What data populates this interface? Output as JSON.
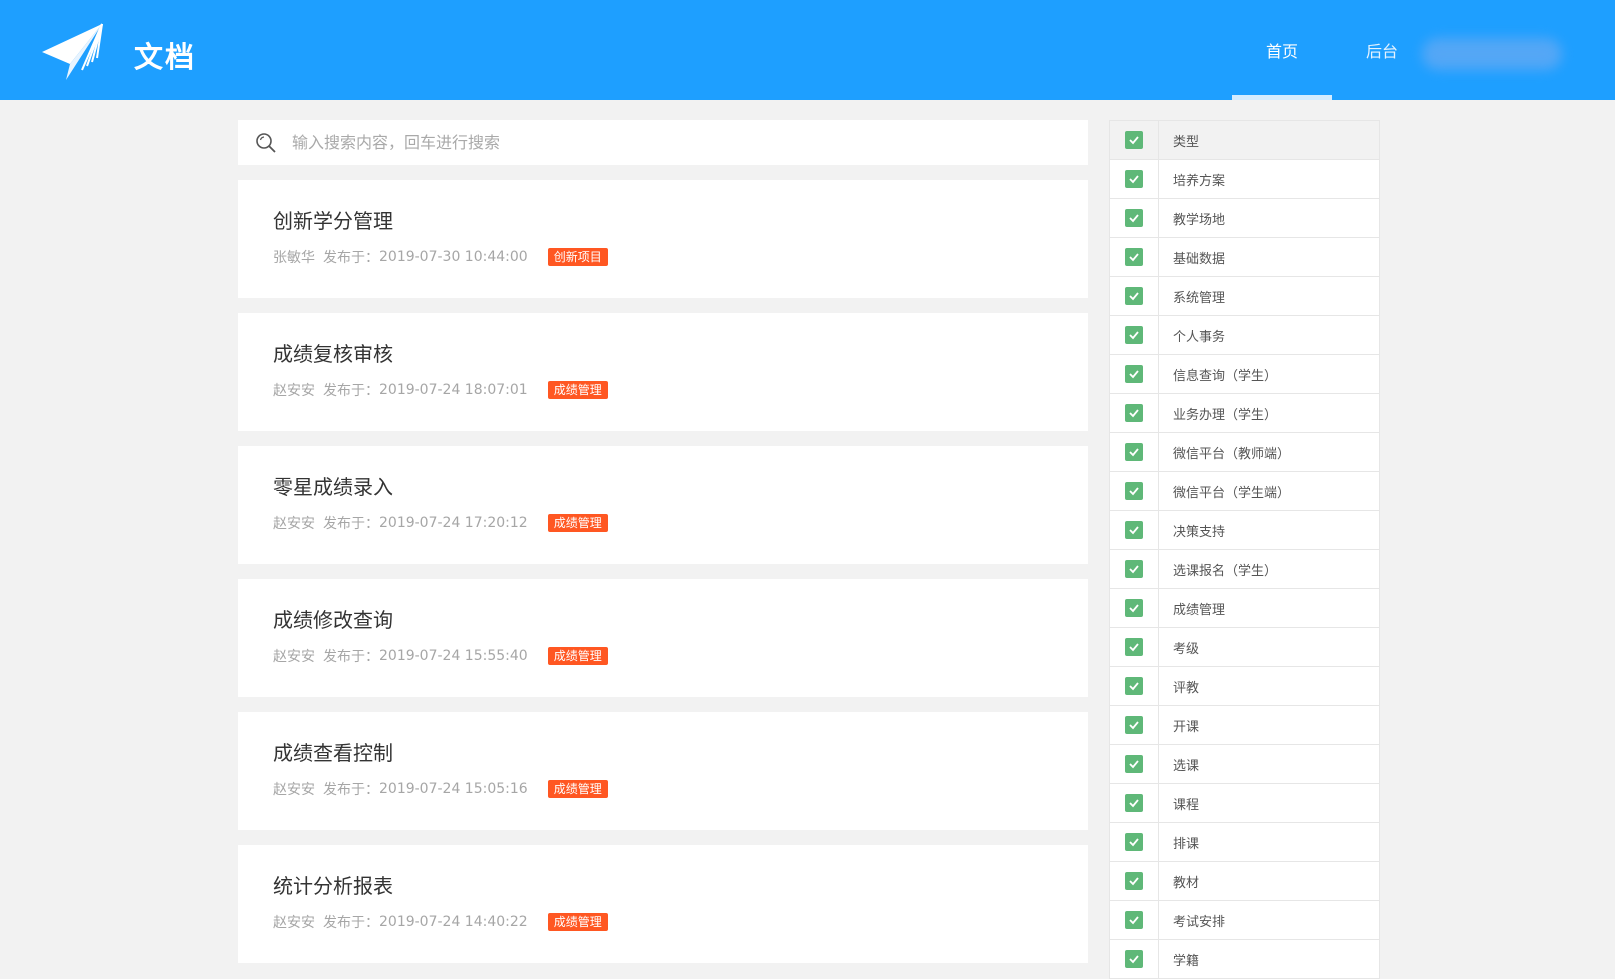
{
  "header": {
    "brand": "文档",
    "logo_icon": "paper-plane-icon",
    "nav": [
      {
        "label": "首页",
        "active": true
      },
      {
        "label": "后台",
        "active": false
      }
    ],
    "accent": "#1e9fff"
  },
  "search": {
    "placeholder": "输入搜索内容，回车进行搜索",
    "value": ""
  },
  "docs": [
    {
      "title": "创新学分管理",
      "author": "张敏华",
      "published_label": "发布于：",
      "date": "2019-07-30 10:44:00",
      "tag": "创新项目"
    },
    {
      "title": "成绩复核审核",
      "author": "赵安安",
      "published_label": "发布于：",
      "date": "2019-07-24 18:07:01",
      "tag": "成绩管理"
    },
    {
      "title": "零星成绩录入",
      "author": "赵安安",
      "published_label": "发布于：",
      "date": "2019-07-24 17:20:12",
      "tag": "成绩管理"
    },
    {
      "title": "成绩修改查询",
      "author": "赵安安",
      "published_label": "发布于：",
      "date": "2019-07-24 15:55:40",
      "tag": "成绩管理"
    },
    {
      "title": "成绩查看控制",
      "author": "赵安安",
      "published_label": "发布于：",
      "date": "2019-07-24 15:05:16",
      "tag": "成绩管理"
    },
    {
      "title": "统计分析报表",
      "author": "赵安安",
      "published_label": "发布于：",
      "date": "2019-07-24 14:40:22",
      "tag": "成绩管理"
    }
  ],
  "filter": {
    "header": "类型",
    "items": [
      "培养方案",
      "教学场地",
      "基础数据",
      "系统管理",
      "个人事务",
      "信息查询（学生）",
      "业务办理（学生）",
      "微信平台（教师端）",
      "微信平台（学生端）",
      "决策支持",
      "选课报名（学生）",
      "成绩管理",
      "考级",
      "评教",
      "开课",
      "选课",
      "课程",
      "排课",
      "教材",
      "考试安排",
      "学籍"
    ],
    "checked_color": "#5fb878"
  }
}
